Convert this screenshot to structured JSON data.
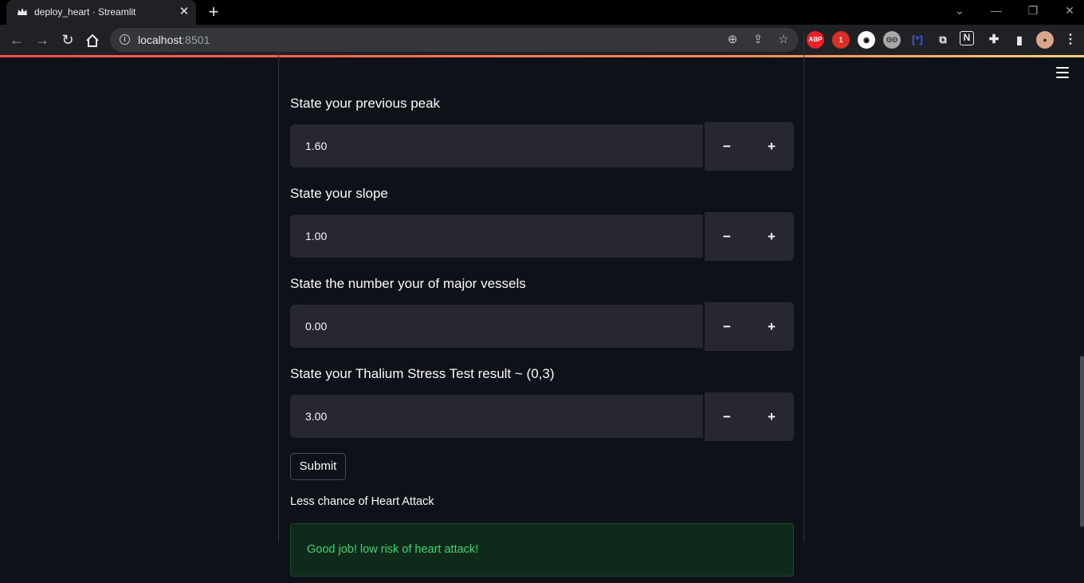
{
  "browser": {
    "tab_title": "deploy_heart · Streamlit",
    "url_host": "localhost",
    "url_port": ":8501",
    "new_tab_label": "+",
    "extensions": [
      {
        "name": "adblock-plus-icon",
        "text": "ABP",
        "color": "#e8202a"
      },
      {
        "name": "extension-badge-icon",
        "text": "1",
        "color": "#d93025"
      }
    ]
  },
  "form": {
    "fields": [
      {
        "label": "State your previous peak",
        "value": "1.60"
      },
      {
        "label": "State your slope",
        "value": "1.00"
      },
      {
        "label": "State the number your of major vessels",
        "value": "0.00"
      },
      {
        "label": "State your Thalium Stress Test result ~ (0,3)",
        "value": "3.00"
      }
    ],
    "minus_label": "−",
    "plus_label": "+",
    "submit_label": "Submit"
  },
  "result": {
    "text": "Less chance of Heart Attack",
    "success_message": "Good job! low risk of heart attack!",
    "success_color": "#3dd56d"
  },
  "theme": {
    "background": "#0e1117",
    "input_background": "#262730",
    "accent": "#ff4b4b"
  }
}
